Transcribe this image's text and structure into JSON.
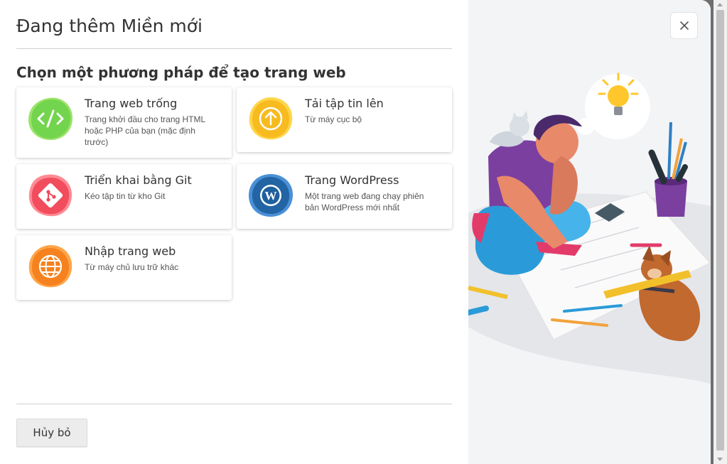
{
  "dialog": {
    "title": "Đang thêm Miền mới",
    "subtitle": "Chọn một phương pháp để tạo trang web",
    "cancel_label": "Hủy bỏ"
  },
  "options": [
    {
      "title": "Trang web trống",
      "desc": "Trang khởi đầu cho trang HTML hoặc PHP của bạn (mặc định trước)",
      "icon": "code-icon",
      "color": "#7ed957"
    },
    {
      "title": "Tải tập tin lên",
      "desc": "Từ máy cục bộ",
      "icon": "upload-icon",
      "color": "#f7c12a"
    },
    {
      "title": "Triển khai bằng Git",
      "desc": "Kéo tập tin từ kho Git",
      "icon": "git-icon",
      "color": "#f4515f"
    },
    {
      "title": "Trang WordPress",
      "desc": "Một trang web đang chạy phiên bản WordPress mới nhất",
      "icon": "wordpress-icon",
      "color": "#2a74b8"
    },
    {
      "title": "Nhập trang web",
      "desc": "Từ máy chủ lưu trữ khác",
      "icon": "globe-import-icon",
      "color": "#f7872a"
    }
  ],
  "illustration": "person-planning-illustration",
  "close_icon": "close-icon"
}
